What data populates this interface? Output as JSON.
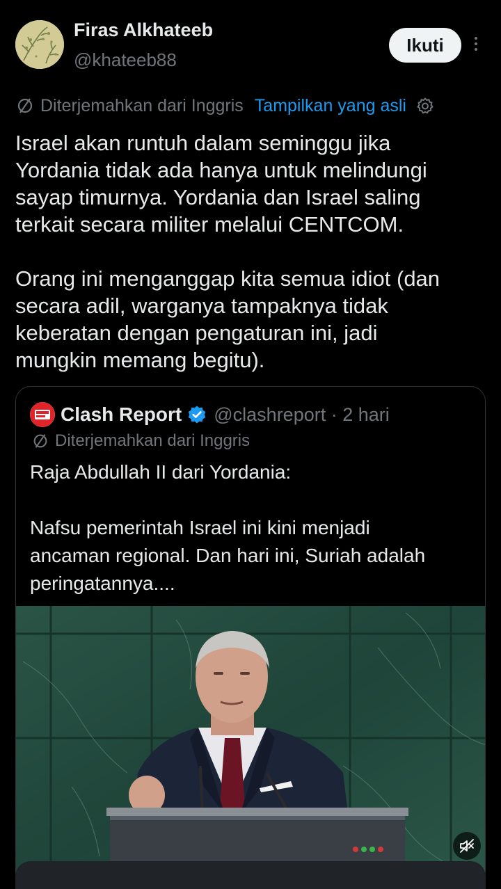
{
  "author": {
    "display_name": "Firas Alkhateeb",
    "handle": "@khateeb88"
  },
  "follow_button": {
    "label": "Ikuti"
  },
  "translation": {
    "note": "Diterjemahkan dari Inggris",
    "show_original": "Tampilkan yang asli"
  },
  "tweet": {
    "text": "Israel akan runtuh dalam seminggu jika\nYordania tidak ada hanya untuk melindungi\nsayap timurnya. Yordania dan Israel saling\nterkait secara militer melalui CENTCOM.\n\nOrang ini menganggap kita semua idiot (dan\nsecara adil, warganya tampaknya tidak\nkeberatan dengan pengaturan ini, jadi\nmungkin memang begitu)."
  },
  "quote": {
    "name": "Clash Report",
    "handle_time": "@clashreport · 2 hari",
    "translation_note": "Diterjemahkan dari Inggris",
    "text": "Raja Abdullah II dari Yordania:\n\nNafsu pemerintah Israel ini kini menjadi\nancaman regional. Dan hari ini, Suriah adalah\nperingatannya....",
    "avatar_text": "CLASH REPORT",
    "media": {
      "description_icon": "video-thumbnail",
      "mute_icon": "muted-speaker-icon"
    }
  },
  "colors": {
    "background": "#000000",
    "text": "#e7e9ea",
    "secondary": "#71767b",
    "link": "#1d9bf0",
    "verified": "#1d9bf0",
    "brand_red": "#e0242a"
  }
}
